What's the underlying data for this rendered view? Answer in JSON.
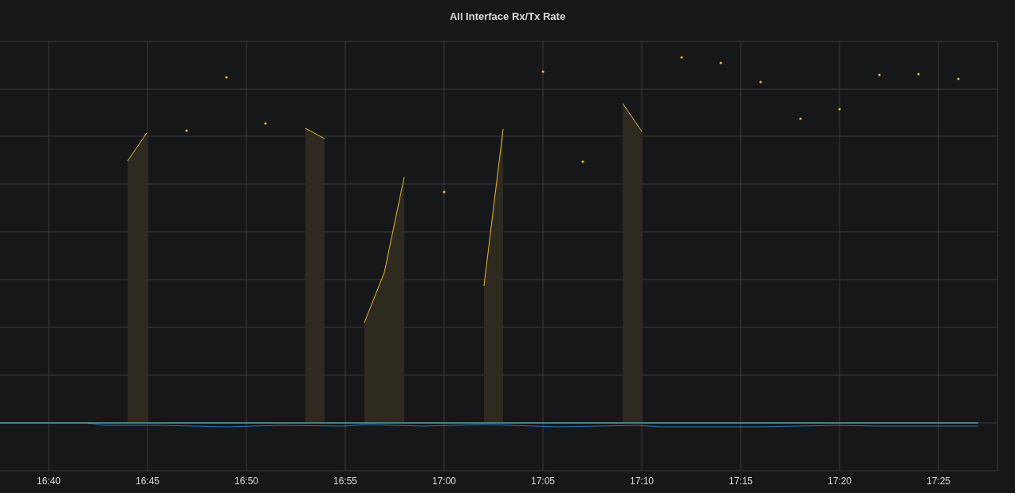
{
  "panel": {
    "title": "All Interface Rx/Tx Rate"
  },
  "x_axis": {
    "tick_labels": [
      "16:40",
      "16:45",
      "16:50",
      "16:55",
      "17:00",
      "17:05",
      "17:10",
      "17:15",
      "17:20",
      "17:25"
    ]
  }
}
